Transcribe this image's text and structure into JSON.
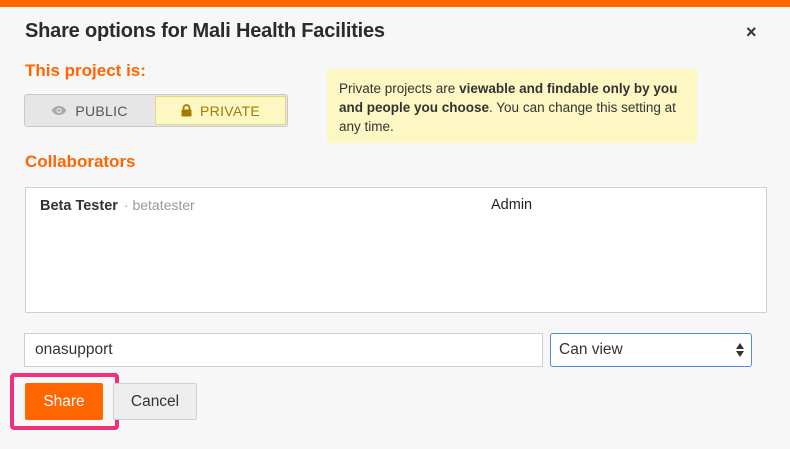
{
  "dialog": {
    "title": "Share options for Mali Health Facilities",
    "close_label": "×"
  },
  "privacy": {
    "label": "This project is:",
    "public_label": "PUBLIC",
    "private_label": "PRIVATE",
    "selected": "private",
    "info_prefix": "Private projects are ",
    "info_bold": "viewable and findable only by you and people you choose",
    "info_suffix": ". You can change this setting at any time."
  },
  "collaborators": {
    "label": "Collaborators",
    "rows": [
      {
        "name": "Beta Tester",
        "username": "· betatester",
        "role": "Admin"
      }
    ]
  },
  "form": {
    "username_value": "onasupport",
    "permission_value": "Can view"
  },
  "buttons": {
    "share": "Share",
    "cancel": "Cancel"
  },
  "colors": {
    "accent": "#ff6600",
    "info_bg": "#fdf7c4",
    "highlight": "#f0307a"
  }
}
